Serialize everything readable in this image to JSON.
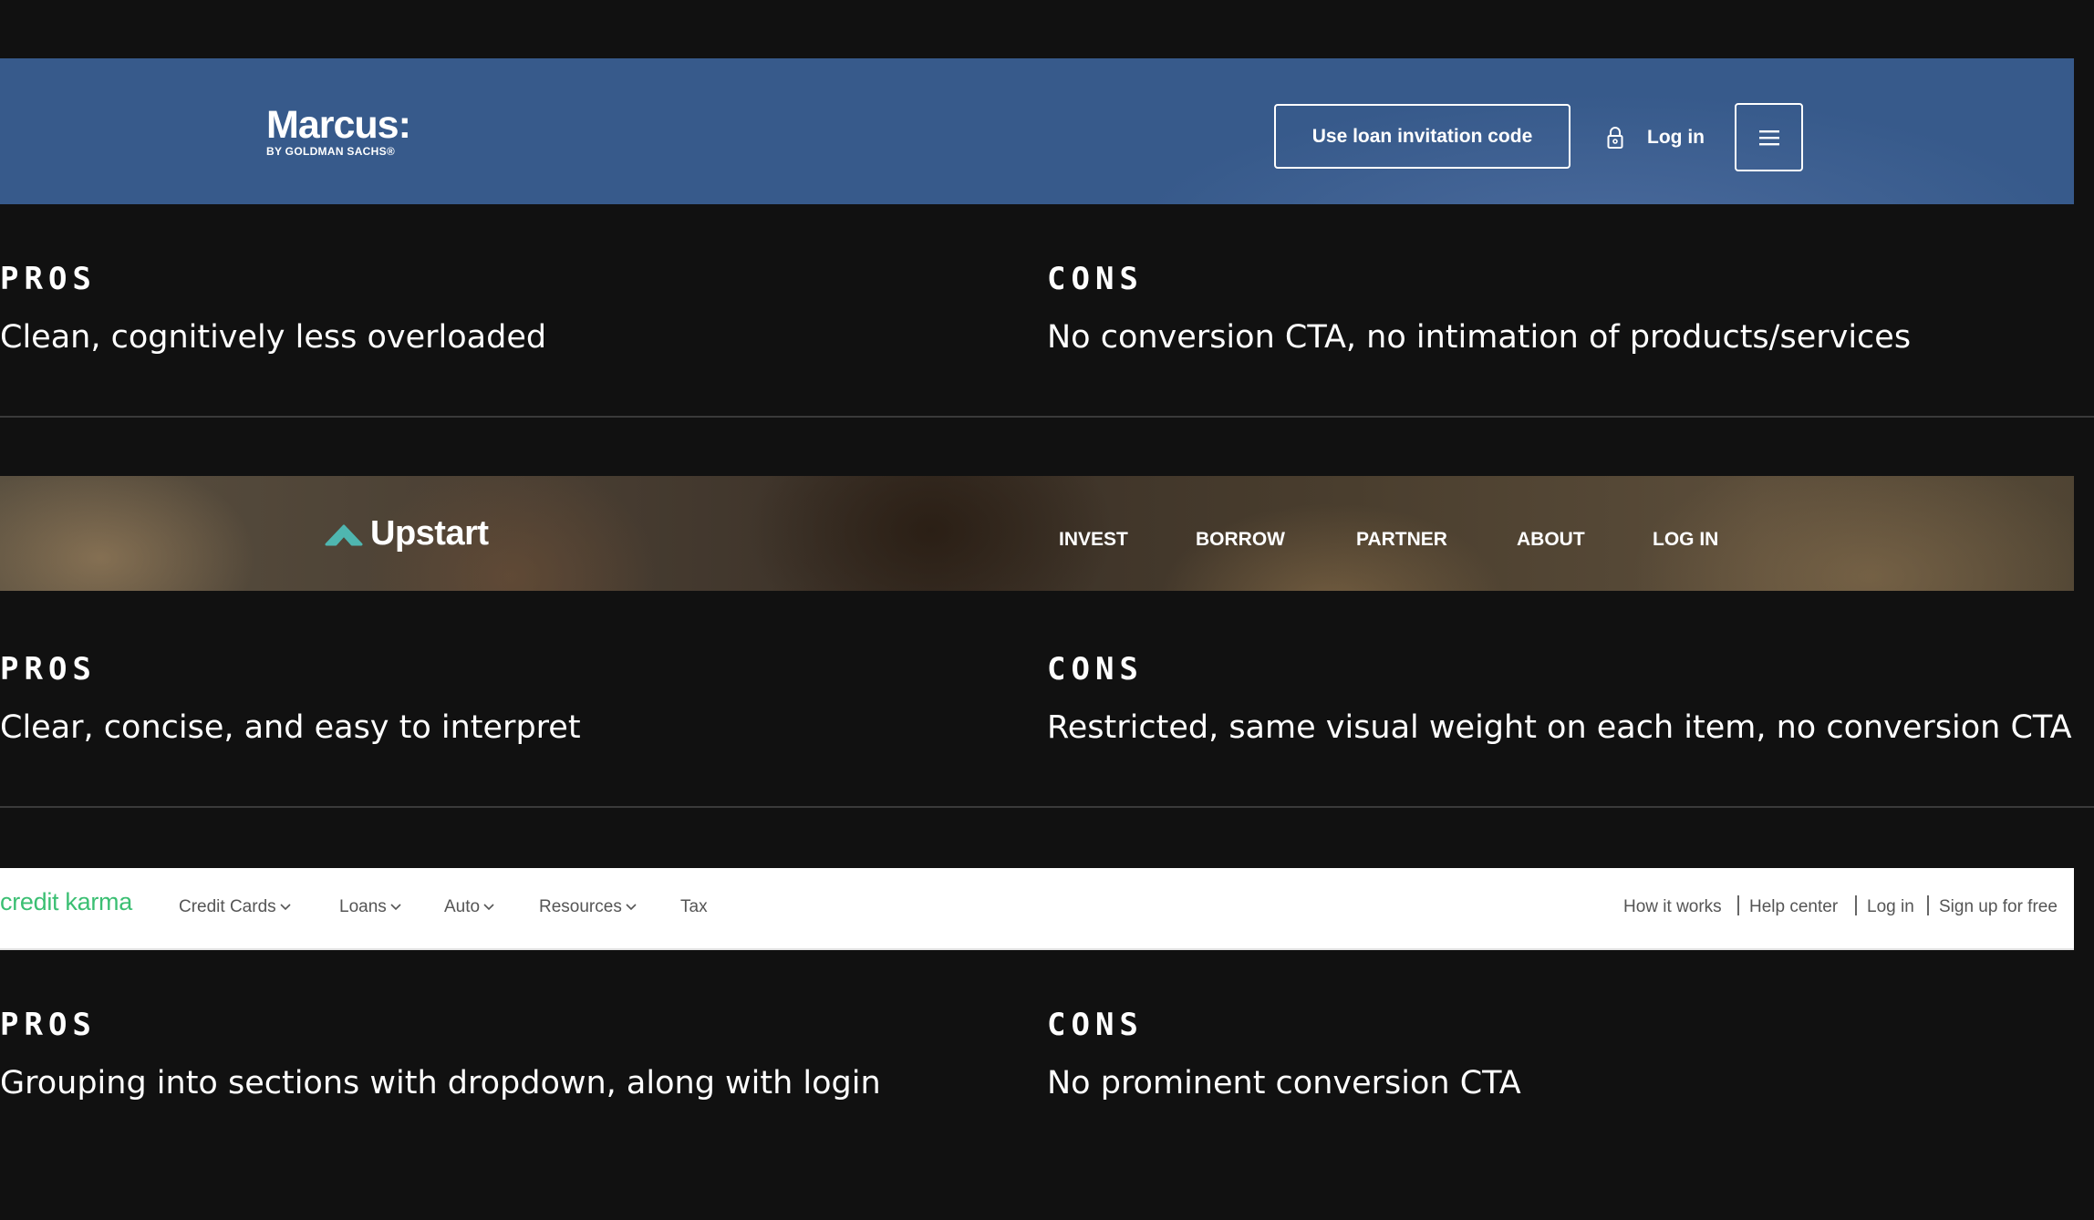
{
  "marcus": {
    "logo_name": "Marcus:",
    "logo_sub": "BY GOLDMAN SACHS®",
    "invite_button": "Use loan invitation code",
    "login_label": "Log in",
    "lock_icon": "lock-icon",
    "menu_icon": "hamburger-menu-icon",
    "background": "#375a8b",
    "pros_heading": "PROS",
    "pros_text": "Clean, cognitively less overloaded",
    "cons_heading": "CONS",
    "cons_text": "No conversion CTA, no intimation of products/services"
  },
  "upstart": {
    "logo_name": "Upstart",
    "logo_icon": "upstart-chevron-logo",
    "logo_color": "#4fb6b0",
    "nav": [
      "INVEST",
      "BORROW",
      "PARTNER",
      "ABOUT",
      "LOG IN"
    ],
    "pros_heading": "PROS",
    "pros_text": "Clear, concise, and easy to interpret",
    "cons_heading": "CONS",
    "cons_text": "Restricted, same visual weight on each item, no conversion CTA"
  },
  "creditkarma": {
    "logo_name": "credit karma",
    "logo_color": "#3bbf73",
    "nav": [
      "Credit Cards",
      "Loans",
      "Auto",
      "Resources",
      "Tax"
    ],
    "right_links": [
      "How it works",
      "Help center",
      "Log in",
      "Sign up for free"
    ],
    "pros_heading": "PROS",
    "pros_text": "Grouping into sections with dropdown, along with login",
    "cons_heading": "CONS",
    "cons_text": "No prominent conversion CTA"
  }
}
